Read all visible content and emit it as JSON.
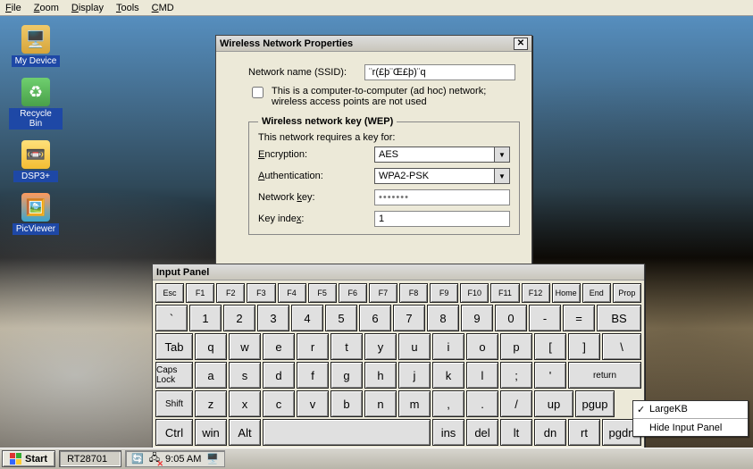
{
  "menubar": [
    "File",
    "Zoom",
    "Display",
    "Tools",
    "CMD"
  ],
  "desktop_icons": [
    {
      "key": "my-device",
      "label": "My Device"
    },
    {
      "key": "recycle-bin",
      "label": "Recycle Bin"
    },
    {
      "key": "dsp3",
      "label": "DSP3+"
    },
    {
      "key": "picviewer",
      "label": "PicViewer"
    }
  ],
  "wnp": {
    "title": "Wireless Network Properties",
    "ssid_label": "Network name (SSID):",
    "ssid_value": "¨r(£þ¨Œ£þ)¨q",
    "adhoc_text": "This is a computer-to-computer (ad hoc) network; wireless access points are not used",
    "adhoc_checked": false,
    "wep_legend": "Wireless network key (WEP)",
    "requires_text": "This network requires a key for:",
    "encryption_label": "Encryption:",
    "encryption_value": "AES",
    "auth_label": "Authentication:",
    "auth_value": "WPA2-PSK",
    "netkey_label": "Network key:",
    "netkey_mask": "•••••••",
    "keyidx_label": "Key index:",
    "keyidx_value": "1"
  },
  "input_panel": {
    "title": "Input Panel",
    "row0": [
      "Esc",
      "F1",
      "F2",
      "F3",
      "F4",
      "F5",
      "F6",
      "F7",
      "F8",
      "F9",
      "F10",
      "F11",
      "F12",
      "Home",
      "End",
      "Prop"
    ],
    "row1": [
      "`",
      "1",
      "2",
      "3",
      "4",
      "5",
      "6",
      "7",
      "8",
      "9",
      "0",
      "-",
      "=",
      "BS"
    ],
    "row2": [
      "Tab",
      "q",
      "w",
      "e",
      "r",
      "t",
      "y",
      "u",
      "i",
      "o",
      "p",
      "[",
      "]",
      "\\"
    ],
    "row3": [
      "Caps Lock",
      "a",
      "s",
      "d",
      "f",
      "g",
      "h",
      "j",
      "k",
      "l",
      ";",
      "'",
      "return"
    ],
    "row4": [
      "Shift",
      "z",
      "x",
      "c",
      "v",
      "b",
      "n",
      "m",
      ",",
      ".",
      "/",
      "up",
      "pgup"
    ],
    "row5": [
      "Ctrl",
      "win",
      "Alt",
      "",
      "ins",
      "del",
      "lt",
      "dn",
      "rt",
      "pgdn"
    ]
  },
  "context_menu": {
    "item1": "LargeKB",
    "item2": "Hide Input Panel"
  },
  "taskbar": {
    "start": "Start",
    "task1": "RT28701",
    "clock": "9:05 AM"
  }
}
